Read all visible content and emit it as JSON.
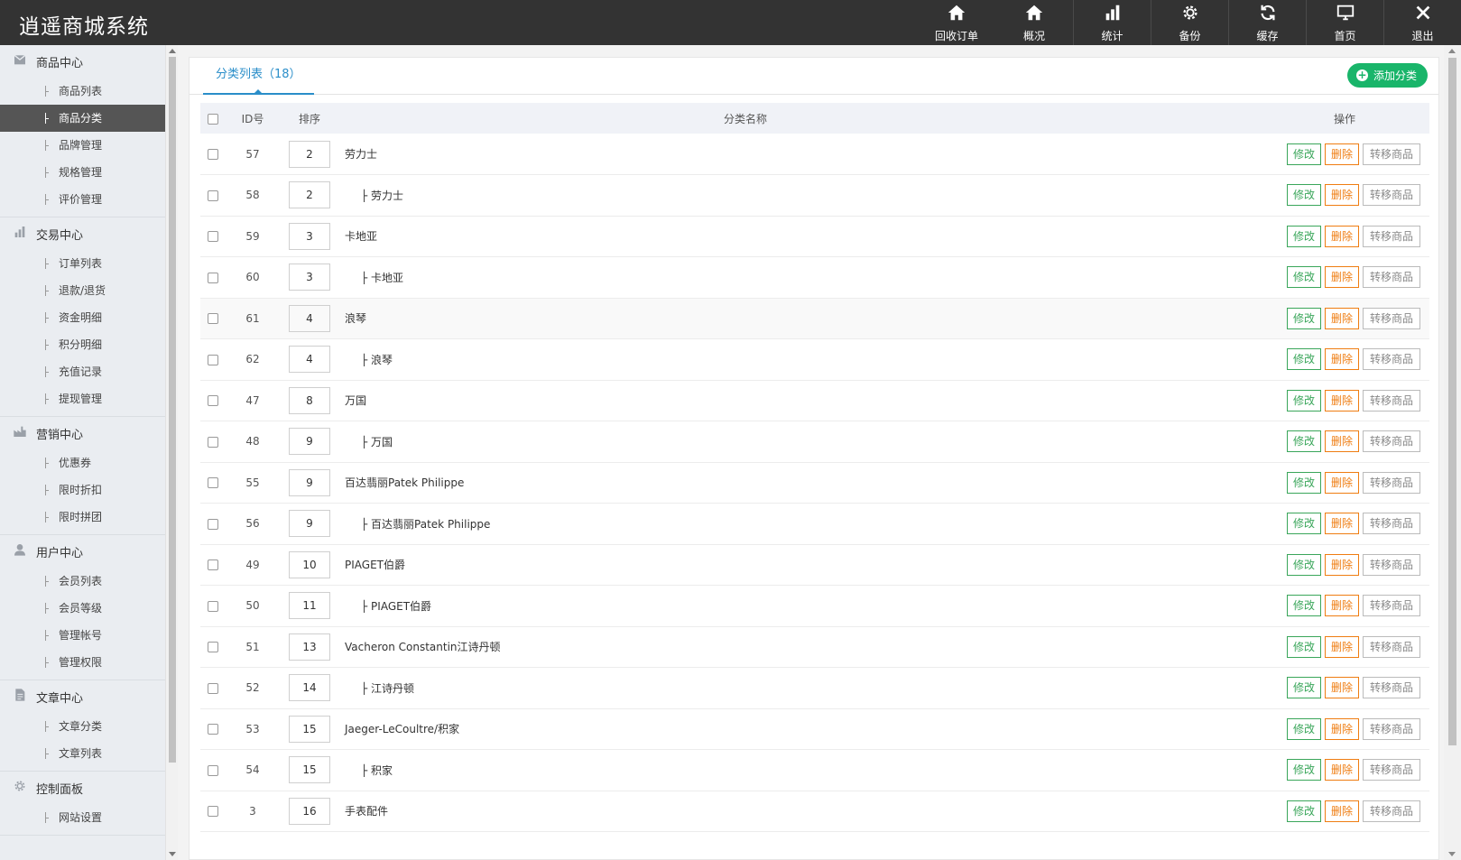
{
  "app": {
    "title": "逍遥商城系统"
  },
  "topnav": [
    {
      "label": "回收订单",
      "icon": "home-icon"
    },
    {
      "label": "概况",
      "icon": "home-icon"
    },
    {
      "label": "统计",
      "icon": "bar-chart-icon"
    },
    {
      "label": "备份",
      "icon": "gear-icon"
    },
    {
      "label": "缓存",
      "icon": "refresh-icon"
    },
    {
      "label": "首页",
      "icon": "monitor-icon"
    },
    {
      "label": "退出",
      "icon": "close-icon"
    }
  ],
  "sidebar": {
    "groups": [
      {
        "label": "商品中心",
        "icon": "box-icon",
        "items": [
          "商品列表",
          "商品分类",
          "品牌管理",
          "规格管理",
          "评价管理"
        ]
      },
      {
        "label": "交易中心",
        "icon": "bar-chart-icon",
        "items": [
          "订单列表",
          "退款/退货",
          "资金明细",
          "积分明细",
          "充值记录",
          "提现管理"
        ]
      },
      {
        "label": "营销中心",
        "icon": "factory-icon",
        "items": [
          "优惠券",
          "限时折扣",
          "限时拼团"
        ]
      },
      {
        "label": "用户中心",
        "icon": "user-icon",
        "items": [
          "会员列表",
          "会员等级",
          "管理帐号",
          "管理权限"
        ]
      },
      {
        "label": "文章中心",
        "icon": "document-icon",
        "items": [
          "文章分类",
          "文章列表"
        ]
      },
      {
        "label": "控制面板",
        "icon": "gear-icon",
        "items": [
          "网站设置"
        ]
      }
    ],
    "active_item": "商品分类"
  },
  "tab": {
    "label": "分类列表（18）"
  },
  "add_button": {
    "label": "添加分类"
  },
  "table": {
    "headers": {
      "id": "ID号",
      "sort": "排序",
      "name": "分类名称",
      "ops": "操作"
    },
    "actions": {
      "edit": "修改",
      "delete": "删除",
      "move": "转移商品"
    },
    "rows": [
      {
        "id": "57",
        "sort": "2",
        "name": "劳力士"
      },
      {
        "id": "58",
        "sort": "2",
        "name": "├ 劳力士"
      },
      {
        "id": "59",
        "sort": "3",
        "name": "卡地亚"
      },
      {
        "id": "60",
        "sort": "3",
        "name": "├ 卡地亚"
      },
      {
        "id": "61",
        "sort": "4",
        "name": "浪琴"
      },
      {
        "id": "62",
        "sort": "4",
        "name": "├ 浪琴"
      },
      {
        "id": "47",
        "sort": "8",
        "name": "万国"
      },
      {
        "id": "48",
        "sort": "9",
        "name": "├ 万国"
      },
      {
        "id": "55",
        "sort": "9",
        "name": "百达翡丽Patek Philippe"
      },
      {
        "id": "56",
        "sort": "9",
        "name": "├ 百达翡丽Patek Philippe"
      },
      {
        "id": "49",
        "sort": "10",
        "name": "PIAGET伯爵"
      },
      {
        "id": "50",
        "sort": "11",
        "name": "├ PIAGET伯爵"
      },
      {
        "id": "51",
        "sort": "13",
        "name": "Vacheron Constantin江诗丹顿"
      },
      {
        "id": "52",
        "sort": "14",
        "name": "├ 江诗丹顿"
      },
      {
        "id": "53",
        "sort": "15",
        "name": "Jaeger-LeCoultre/积家"
      },
      {
        "id": "54",
        "sort": "15",
        "name": "├ 积家"
      },
      {
        "id": "3",
        "sort": "16",
        "name": "手表配件"
      }
    ],
    "highlighted_row": "61"
  }
}
